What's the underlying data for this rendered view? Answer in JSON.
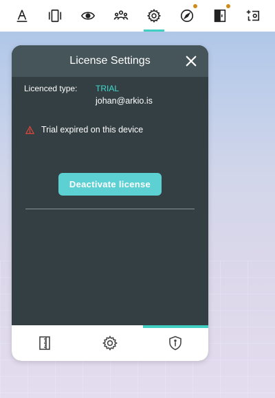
{
  "colors": {
    "accent": "#3fcfc3",
    "panel_bg": "#343f43",
    "header_bg": "#46555a",
    "button_bg": "#5cd0d2",
    "warning": "#e0473a",
    "notification_dot": "#d08a1a"
  },
  "toolbar": {
    "items": [
      {
        "icon": "level-tool-icon"
      },
      {
        "icon": "view-panels-icon"
      },
      {
        "icon": "eye-icon"
      },
      {
        "icon": "people-icon"
      },
      {
        "icon": "gear-icon",
        "active": true
      },
      {
        "icon": "compass-icon",
        "notification": true
      },
      {
        "icon": "door-icon",
        "notification": true
      },
      {
        "icon": "add-camera-icon"
      }
    ]
  },
  "panel": {
    "title": "License Settings",
    "license_label": "Licenced type:",
    "license_type": "TRIAL",
    "email": "johan@arkio.is",
    "warning_text": "Trial expired on this device",
    "deactivate_label": "Deactivate license"
  },
  "bottom_tabs": [
    {
      "icon": "ruler-book-icon"
    },
    {
      "icon": "settings-gear-icon"
    },
    {
      "icon": "shield-info-icon",
      "active": true
    }
  ]
}
